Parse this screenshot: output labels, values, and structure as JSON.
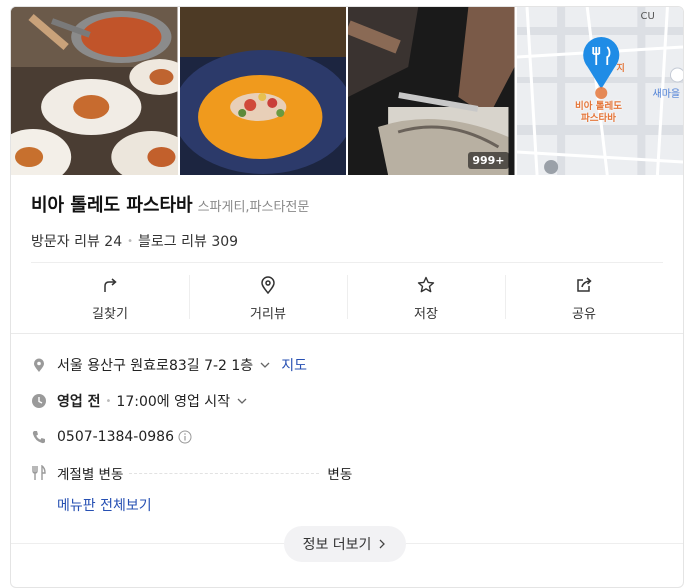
{
  "photos": {
    "count_badge": "999+"
  },
  "map": {
    "pin_label_line1": "비아 톨레도",
    "pin_label_line2": "파스타바",
    "label_cu": "CU",
    "label_saemaeul": "새마을",
    "label_ji": "지"
  },
  "place": {
    "name": "비아 톨레도 파스타바",
    "category": "스파게티,파스타전문",
    "visitor_reviews": "방문자 리뷰 24",
    "blog_reviews": "블로그 리뷰 309"
  },
  "actions": [
    {
      "label": "길찾기",
      "icon": "directions-icon"
    },
    {
      "label": "거리뷰",
      "icon": "streetview-pin-icon"
    },
    {
      "label": "저장",
      "icon": "star-icon"
    },
    {
      "label": "공유",
      "icon": "share-icon"
    }
  ],
  "info": {
    "address": "서울 용산구 원효로83길 7-2 1층",
    "map_link": "지도",
    "hours_status": "영업 전",
    "hours_detail": "17:00에 영업 시작",
    "phone": "0507-1384-0986",
    "menu_item": "계절별 변동",
    "menu_price": "변동",
    "menu_full_link": "메뉴판 전체보기"
  },
  "more_button": "정보 더보기",
  "colors": {
    "link": "#2750b3",
    "map_pin": "#1f8ce6",
    "pin_label": "#e4763a"
  }
}
